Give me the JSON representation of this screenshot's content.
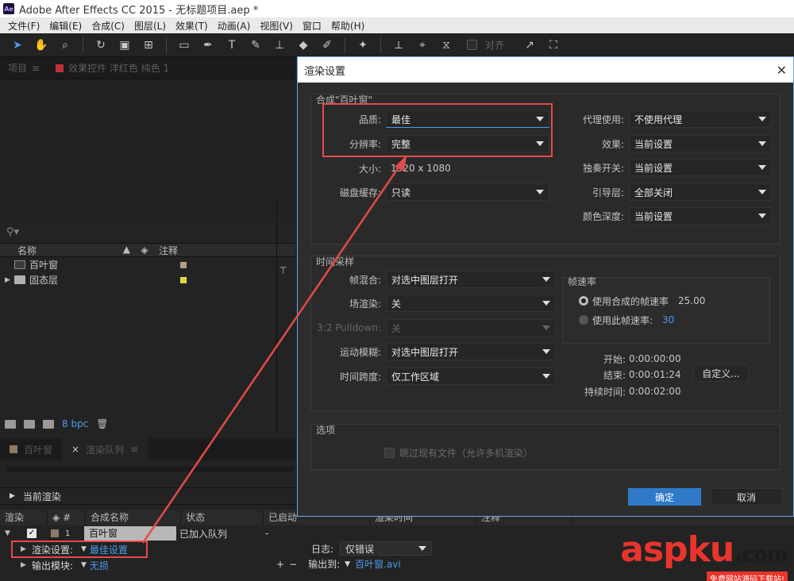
{
  "app": {
    "title": "Adobe After Effects CC 2015 - 无标题项目.aep *",
    "icon_text": "Ae"
  },
  "menu": [
    "文件(F)",
    "编辑(E)",
    "合成(C)",
    "图层(L)",
    "效果(T)",
    "动画(A)",
    "视图(V)",
    "窗口",
    "帮助(H)"
  ],
  "toolbar": {
    "tools": [
      "selection-tool",
      "hand-tool",
      "zoom-tool",
      "rotate-tool",
      "camera-tool",
      "pan-behind-tool",
      "rectangle-tool",
      "pen-tool",
      "type-tool",
      "brush-tool",
      "clone-stamp-tool",
      "eraser-tool",
      "roto-brush-tool",
      "puppet-tool"
    ],
    "snap_label": "对齐"
  },
  "project_panel": {
    "tab_project": "项目",
    "tab_effects": "效果控件 洋红色 纯色 1",
    "search_icon": "🔍",
    "col_name": "名称",
    "col_comment": "注释",
    "items": [
      {
        "name": "百叶窗",
        "type": "composition",
        "label_color": "#b39f84"
      },
      {
        "name": "固态层",
        "type": "folder",
        "label_color": "#e4d44a"
      }
    ],
    "bpc": "8 bpc"
  },
  "queue_panel": {
    "tab_comp": "百叶窗",
    "tab_queue": "渲染队列",
    "current_render": "当前渲染",
    "headers": [
      "渲染",
      "#",
      "合成名称",
      "状态",
      "已启动",
      "渲染时间",
      "注释"
    ],
    "row": {
      "num": "1",
      "comp": "百叶窗",
      "status": "已加入队列",
      "started": "-"
    },
    "render_settings_label": "渲染设置:",
    "render_settings_value": "最佳设置",
    "output_module_label": "输出模块:",
    "output_module_value": "无损",
    "log_label": "日志:",
    "log_value": "仅错误",
    "output_to_label": "输出到:",
    "output_to_value": "百叶窗.avi"
  },
  "dialog": {
    "title": "渲染设置",
    "comp_group": "合成\"百叶窗\"",
    "quality_label": "品质:",
    "quality_value": "最佳",
    "resolution_label": "分辨率:",
    "resolution_value": "完整",
    "size_label": "大小:",
    "size_value": "1920 x 1080",
    "disk_cache_label": "磁盘缓存:",
    "disk_cache_value": "只读",
    "proxy_label": "代理使用:",
    "proxy_value": "不使用代理",
    "effects_label": "效果:",
    "effects_value": "当前设置",
    "solo_label": "独奏开关:",
    "solo_value": "当前设置",
    "guide_label": "引导层:",
    "guide_value": "全部关闭",
    "color_depth_label": "颜色深度:",
    "color_depth_value": "当前设置",
    "time_group": "时间采样",
    "frame_blend_label": "帧混合:",
    "frame_blend_value": "对选中图层打开",
    "field_render_label": "场渲染:",
    "field_render_value": "关",
    "pulldown_label": "3:2 Pulldown:",
    "pulldown_value": "关",
    "motion_blur_label": "运动模糊:",
    "motion_blur_value": "对选中图层打开",
    "time_span_label": "时间跨度:",
    "time_span_value": "仅工作区域",
    "frame_rate_group": "帧速率",
    "use_comp_rate_label": "使用合成的帧速率",
    "comp_rate_value": "25.00",
    "use_this_rate_label": "使用此帧速率:",
    "this_rate_value": "30",
    "start_label": "开始:",
    "start_value": "0:00:00:00",
    "end_label": "结束:",
    "end_value": "0:00:01:24",
    "duration_label": "持续时间:",
    "duration_value": "0:00:02:00",
    "custom_button": "自定义...",
    "options_group": "选项",
    "skip_existing_label": "跳过现有文件（允许多机渲染）",
    "ok_button": "确定",
    "cancel_button": "取消",
    "close_icon": "✕"
  },
  "annotation_color": "#e24b4b",
  "watermark": {
    "logo_main": "aspku",
    "logo_dot": ".",
    "logo_com": "com",
    "tagline": "免费网站源码下载站!"
  }
}
